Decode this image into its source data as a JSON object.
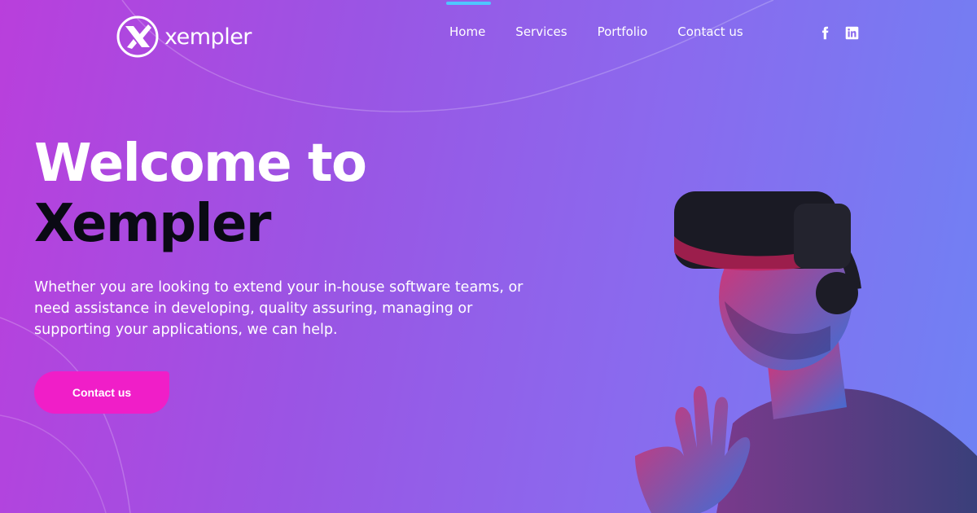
{
  "brand": {
    "name": "xempler"
  },
  "nav": {
    "items": [
      {
        "label": "Home",
        "active": true
      },
      {
        "label": "Services"
      },
      {
        "label": "Portfolio"
      },
      {
        "label": "Contact us"
      }
    ]
  },
  "social": [
    {
      "icon": "facebook-icon"
    },
    {
      "icon": "linkedin-icon"
    }
  ],
  "hero": {
    "title_line1": "Welcome to",
    "title_line2": "Xempler",
    "description": "Whether you are looking to extend your in-house software teams, or need assistance in developing, quality assuring, managing or supporting your applications, we can help.",
    "cta_label": "Contact us"
  },
  "colors": {
    "accent": "#f01ec8",
    "nav_indicator": "#4fc6ff",
    "gradient_start": "#b93fdc",
    "gradient_end": "#6f82f4"
  }
}
